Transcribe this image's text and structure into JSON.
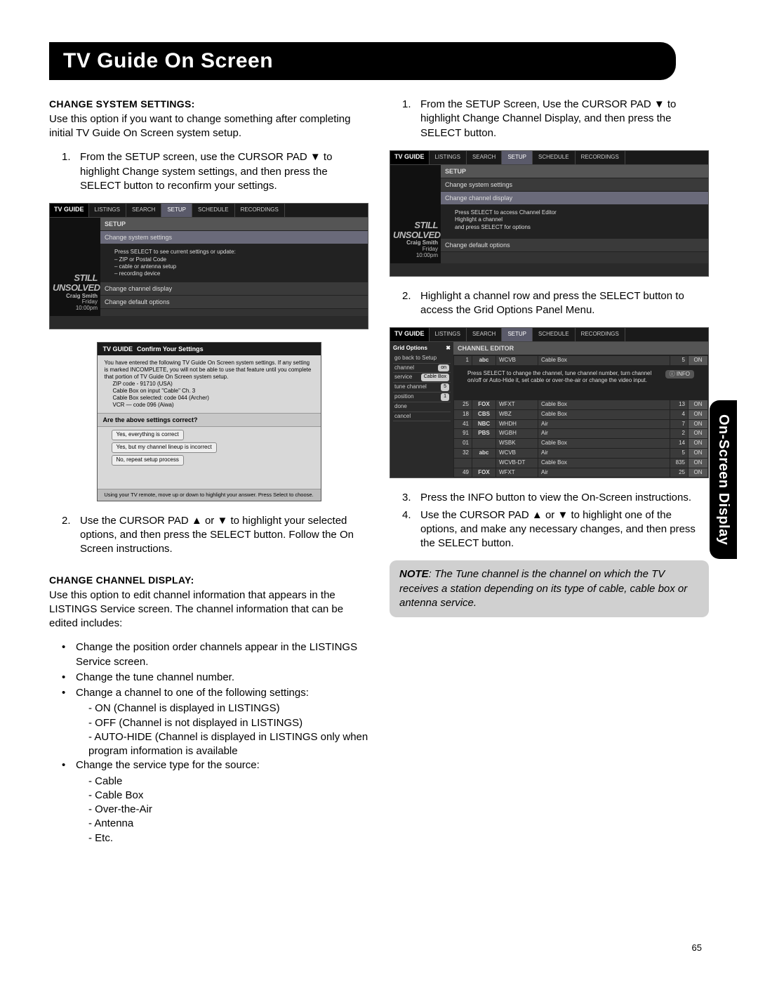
{
  "page_title": "TV Guide On Screen",
  "side_tab": "On-Screen Display",
  "page_number": "65",
  "left": {
    "h1": "CHANGE SYSTEM SETTINGS:",
    "intro1": "Use this option if you want to change something after completing initial TV Guide On Screen system setup.",
    "step1": "From the SETUP screen, use the CURSOR PAD ▼ to highlight  Change system settings, and then press the SELECT button to reconfirm your settings.",
    "step2": "Use the CURSOR PAD ▲ or ▼ to highlight your selected options, and then press the SELECT button.  Follow the On Screen instructions.",
    "h2": "CHANGE CHANNEL DISPLAY:",
    "intro2": "Use this option to edit channel information that appears in the LISTINGS Service screen. The channel information that can be edited includes:",
    "b1": "Change the position order channels appear in the LISTINGS Service screen.",
    "b2": "Change the tune channel number.",
    "b3": "Change a channel to one of the following settings:",
    "b3a": "- ON (Channel is displayed in LISTINGS)",
    "b3b": "- OFF (Channel is not displayed in LISTINGS)",
    "b3c": "- AUTO-HIDE (Channel is displayed in LISTINGS only when program information is available",
    "b4": "Change the service type for the source:",
    "b4a": "- Cable",
    "b4b": "- Cable Box",
    "b4c": "- Over-the-Air",
    "b4d": "- Antenna",
    "b4e": "- Etc."
  },
  "right": {
    "step1": "From the SETUP Screen, Use the CURSOR  PAD ▼ to highlight Change Channel Display, and then press the SELECT button.",
    "step2": "Highlight a channel row and press the SELECT button to access the Grid Options Panel Menu.",
    "step3": "Press the INFO button to view the On-Screen instructions.",
    "step4": "Use the CURSOR PAD ▲ or ▼ to highlight one of the options, and make any necessary changes, and then press the SELECT button.",
    "note_label": "NOTE",
    "note": ":  The Tune channel is the channel on which the TV receives a station depending on its type of cable, cable box or antenna service."
  },
  "tv": {
    "logo": "TV GUIDE",
    "tabs": [
      "LISTINGS",
      "SEARCH",
      "SETUP",
      "SCHEDULE",
      "RECORDINGS"
    ],
    "promo_big1": "STILL",
    "promo_big2": "UNSOLVED",
    "promo_name": "Craig Smith",
    "promo_day": "Friday",
    "promo_time": "10:00pm",
    "setup_head": "SETUP",
    "setup_row_sys": "Change system settings",
    "setup_row_chan": "Change channel display",
    "setup_row_def": "Change default options",
    "setup_info1": "Press SELECT to see current settings or update:\n– ZIP or Postal Code\n– cable or antenna setup\n– recording device",
    "setup_info2": "Press SELECT to access Channel Editor\nHighlight a channel\nand press SELECT for options",
    "dialog_title": "Confirm Your Settings",
    "dialog_body": "You have entered the following TV Guide On Screen system settings. If any setting is marked INCOMPLETE, you will not be able to use that feature until you complete that portion of TV Guide On Screen system setup.",
    "dialog_list": [
      "ZIP code - 91710 (USA)",
      "Cable Box on input \"Cable\" Ch. 3",
      "Cable Box selected: code 044 (Archer)",
      "VCR — code 096 (Aiwa)"
    ],
    "dialog_q": "Are the above settings correct?",
    "dialog_opts": [
      "Yes, everything is correct",
      "Yes, but my channel lineup is incorrect",
      "No, repeat setup process"
    ],
    "dialog_foot": "Using your TV remote, move up or down to highlight your answer.  Press Select to choose.",
    "editor_head": "CHANNEL EDITOR",
    "editor_top": {
      "num": "1",
      "call": "WCVB",
      "svc": "Cable Box",
      "ch": "5",
      "on": "ON"
    },
    "editor_info_btn": "INFO",
    "editor_info": "Press SELECT to change the channel, tune channel number, turn channel on/off or Auto-Hide it, set cable or over-the-air or change the video input.",
    "gridopts_title": "Grid Options",
    "gridopts": [
      {
        "label": "go back to Setup",
        "val": ""
      },
      {
        "label": "channel",
        "val": "on"
      },
      {
        "label": "service",
        "val": "Cable Box"
      },
      {
        "label": "tune channel",
        "val": "5"
      },
      {
        "label": "position",
        "val": "1"
      },
      {
        "label": "done",
        "val": ""
      },
      {
        "label": "cancel",
        "val": ""
      }
    ],
    "rows": [
      {
        "pos": "25",
        "net": "FOX",
        "call": "WFXT",
        "svc": "Cable Box",
        "ch": "13",
        "on": "ON"
      },
      {
        "pos": "18",
        "net": "CBS",
        "call": "WBZ",
        "svc": "Cable Box",
        "ch": "4",
        "on": "ON"
      },
      {
        "pos": "41",
        "net": "NBC",
        "call": "WHDH",
        "svc": "Air",
        "ch": "7",
        "on": "ON"
      },
      {
        "pos": "91",
        "net": "PBS",
        "call": "WGBH",
        "svc": "Air",
        "ch": "2",
        "on": "ON"
      },
      {
        "pos": "01",
        "net": "",
        "call": "WSBK",
        "svc": "Cable Box",
        "ch": "14",
        "on": "ON"
      },
      {
        "pos": "32",
        "net": "abc",
        "call": "WCVB",
        "svc": "Air",
        "ch": "5",
        "on": "ON"
      },
      {
        "pos": "",
        "net": "",
        "call": "WCVB-DT",
        "svc": "Cable Box",
        "ch": "835",
        "on": "ON"
      },
      {
        "pos": "49",
        "net": "FOX",
        "call": "WFXT",
        "svc": "Air",
        "ch": "25",
        "on": "ON"
      }
    ]
  }
}
